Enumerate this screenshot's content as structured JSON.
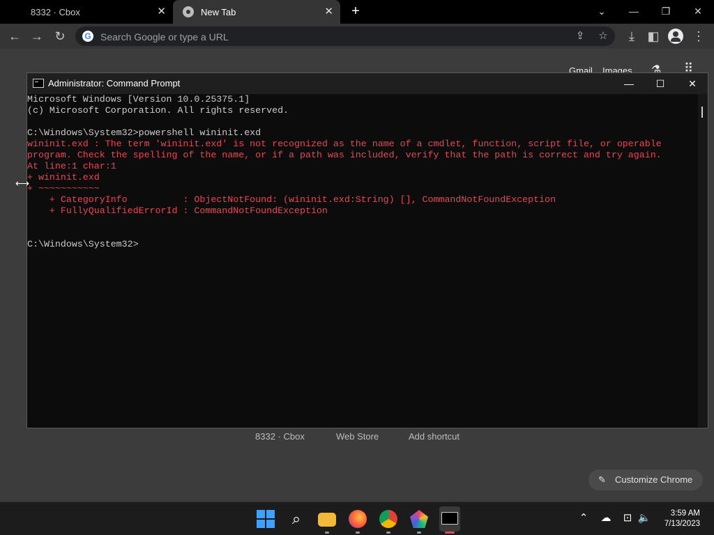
{
  "browser": {
    "tabs": [
      {
        "label": "8332 · Cbox",
        "active": false
      },
      {
        "label": "New Tab",
        "active": true
      }
    ],
    "omnibox_placeholder": "Search Google or type a URL",
    "ntp_links": {
      "gmail": "Gmail",
      "images": "Images"
    },
    "shortcuts": [
      "8332 · Cbox",
      "Web Store",
      "Add shortcut"
    ],
    "customize_label": "Customize Chrome"
  },
  "cmd": {
    "title": "Administrator: Command Prompt",
    "lines": [
      {
        "text": "Microsoft Windows [Version 10.0.25375.1]",
        "kind": "normal"
      },
      {
        "text": "(c) Microsoft Corporation. All rights reserved.",
        "kind": "normal"
      },
      {
        "text": "",
        "kind": "normal"
      },
      {
        "text": "C:\\Windows\\System32>powershell wininit.exd",
        "kind": "normal"
      },
      {
        "text": "wininit.exd : The term 'wininit.exd' is not recognized as the name of a cmdlet, function, script file, or operable",
        "kind": "err"
      },
      {
        "text": "program. Check the spelling of the name, or if a path was included, verify that the path is correct and try again.",
        "kind": "err"
      },
      {
        "text": "At line:1 char:1",
        "kind": "err"
      },
      {
        "text": "+ wininit.exd",
        "kind": "err"
      },
      {
        "text": "+ ~~~~~~~~~~~",
        "kind": "err"
      },
      {
        "text": "    + CategoryInfo          : ObjectNotFound: (wininit.exd:String) [], CommandNotFoundException",
        "kind": "err"
      },
      {
        "text": "    + FullyQualifiedErrorId : CommandNotFoundException",
        "kind": "err"
      },
      {
        "text": "",
        "kind": "normal"
      },
      {
        "text": "",
        "kind": "normal"
      },
      {
        "text": "C:\\Windows\\System32>",
        "kind": "normal"
      }
    ]
  },
  "taskbar": {
    "time": "3:59 AM",
    "date": "7/13/2023",
    "apps": [
      "windows-start",
      "search",
      "file-explorer",
      "firefox",
      "chrome",
      "polygon-app",
      "terminal"
    ]
  },
  "colors": {
    "error_red": "#e74856",
    "console_text": "#cccccc",
    "accent_blue": "#3ea0ff"
  }
}
